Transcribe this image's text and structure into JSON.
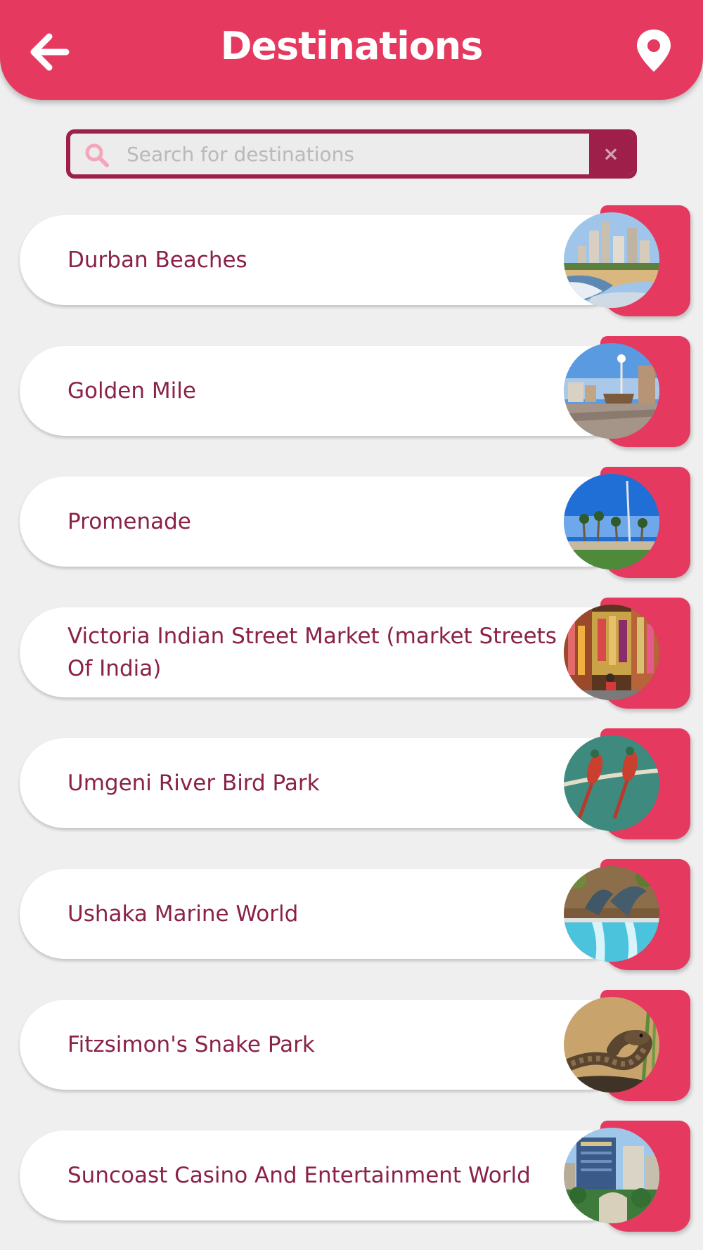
{
  "header": {
    "title": "Destinations",
    "back_icon": "arrow-left-icon",
    "location_icon": "map-pin-icon",
    "color": "#e6395f"
  },
  "search": {
    "placeholder": "Search for destinations",
    "value": "",
    "search_icon": "search-icon",
    "clear_icon": "close-icon",
    "clear_label": "×",
    "border_color": "#9d1f4a"
  },
  "destinations": [
    {
      "name": "Durban Beaches",
      "image": "beach-city-photo"
    },
    {
      "name": "Golden Mile",
      "image": "beachfront-promenade-photo"
    },
    {
      "name": "Promenade",
      "image": "palm-promenade-photo"
    },
    {
      "name": "Victoria Indian Street Market (market Streets Of India)",
      "image": "market-stall-photo"
    },
    {
      "name": "Umgeni River Bird Park",
      "image": "bee-eater-birds-photo"
    },
    {
      "name": "Ushaka Marine World",
      "image": "dolphin-show-photo"
    },
    {
      "name": "Fitzsimon's Snake Park",
      "image": "snake-photo"
    },
    {
      "name": "Suncoast Casino And Entertainment World",
      "image": "casino-building-photo"
    }
  ],
  "colors": {
    "accent": "#e6395f",
    "text": "#8a2148",
    "background": "#efefef"
  }
}
